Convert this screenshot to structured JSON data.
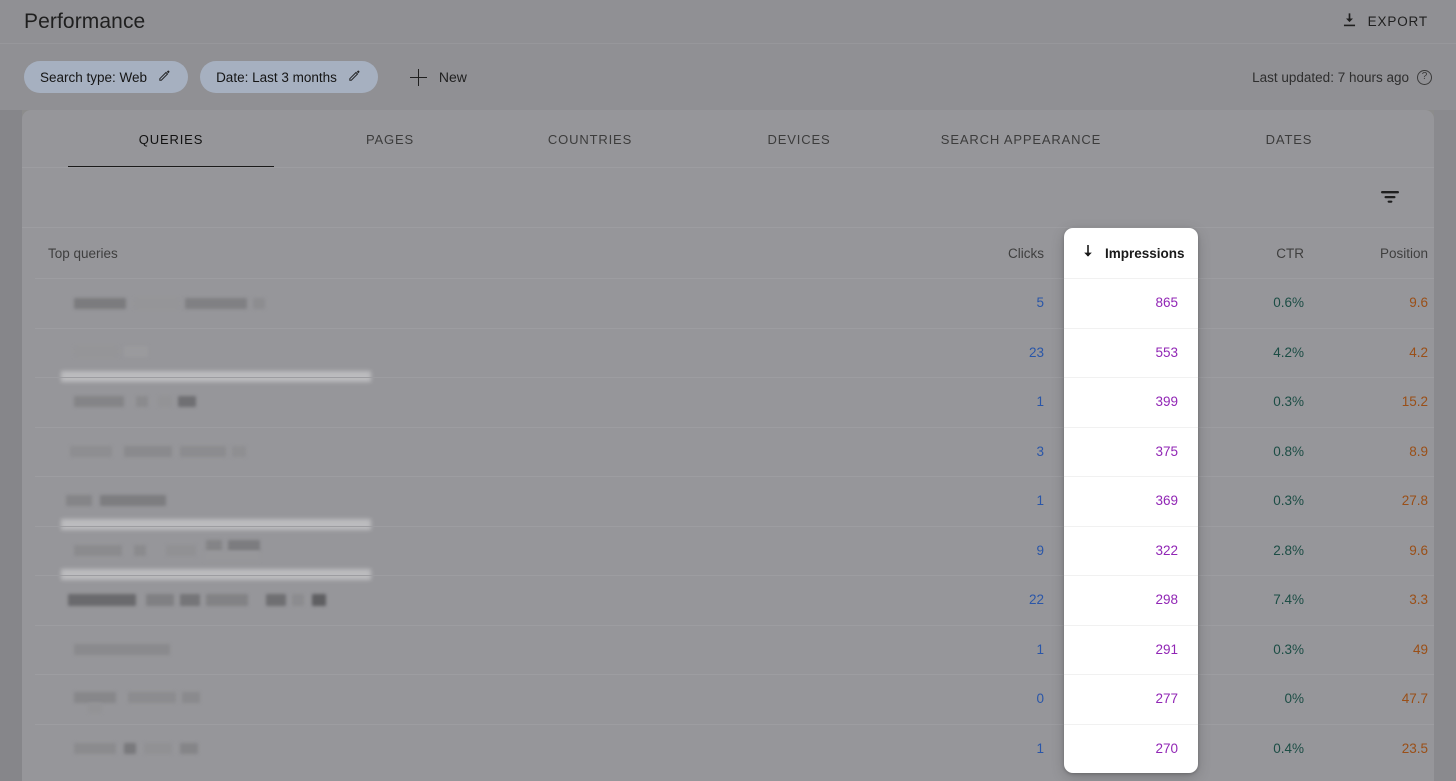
{
  "header": {
    "title": "Performance",
    "export_label": "EXPORT",
    "export_icon": "download-icon"
  },
  "filter_bar": {
    "chips": [
      {
        "label": "Search type: Web",
        "icon": "pencil-icon"
      },
      {
        "label": "Date: Last 3 months",
        "icon": "pencil-icon"
      }
    ],
    "new_label": "New",
    "new_icon": "plus-icon",
    "last_updated": "Last updated: 7 hours ago",
    "help_icon": "help-circle-icon",
    "help_glyph": "?"
  },
  "tabs": [
    {
      "label": "QUERIES",
      "active": true
    },
    {
      "label": "PAGES",
      "active": false
    },
    {
      "label": "COUNTRIES",
      "active": false
    },
    {
      "label": "DEVICES",
      "active": false
    },
    {
      "label": "SEARCH APPEARANCE",
      "active": false
    },
    {
      "label": "DATES",
      "active": false
    }
  ],
  "toolbar": {
    "filter_icon": "filter-funnel-icon"
  },
  "table": {
    "columns": {
      "queries": "Top queries",
      "clicks": "Clicks",
      "impressions": "Impressions",
      "ctr": "CTR",
      "position": "Position"
    },
    "sorted_by": "impressions",
    "sort_direction": "descending",
    "sort_icon": "arrow-down-icon",
    "rows": [
      {
        "query": "",
        "clicks": "5",
        "impressions": "865",
        "ctr": "0.6%",
        "position": "9.6"
      },
      {
        "query": "",
        "clicks": "23",
        "impressions": "553",
        "ctr": "4.2%",
        "position": "4.2"
      },
      {
        "query": "",
        "clicks": "1",
        "impressions": "399",
        "ctr": "0.3%",
        "position": "15.2"
      },
      {
        "query": "",
        "clicks": "3",
        "impressions": "375",
        "ctr": "0.8%",
        "position": "8.9"
      },
      {
        "query": "",
        "clicks": "1",
        "impressions": "369",
        "ctr": "0.3%",
        "position": "27.8"
      },
      {
        "query": "",
        "clicks": "9",
        "impressions": "322",
        "ctr": "2.8%",
        "position": "9.6"
      },
      {
        "query": "",
        "clicks": "22",
        "impressions": "298",
        "ctr": "7.4%",
        "position": "3.3"
      },
      {
        "query": "",
        "clicks": "1",
        "impressions": "291",
        "ctr": "0.3%",
        "position": "49"
      },
      {
        "query": "",
        "clicks": "0",
        "impressions": "277",
        "ctr": "0%",
        "position": "47.7"
      },
      {
        "query": "",
        "clicks": "1",
        "impressions": "270",
        "ctr": "0.4%",
        "position": "23.5"
      }
    ]
  },
  "colors": {
    "page_background": "#8c8c8c",
    "card_background": "#96969a",
    "chip_background": "#a6b0c0",
    "clicks": "#2a56a8",
    "impressions": "#9126b5",
    "ctr": "#1c4d45",
    "position": "#9a4f17",
    "popover_background": "#ffffff",
    "active_tab_underline": "#1a1a1a"
  }
}
